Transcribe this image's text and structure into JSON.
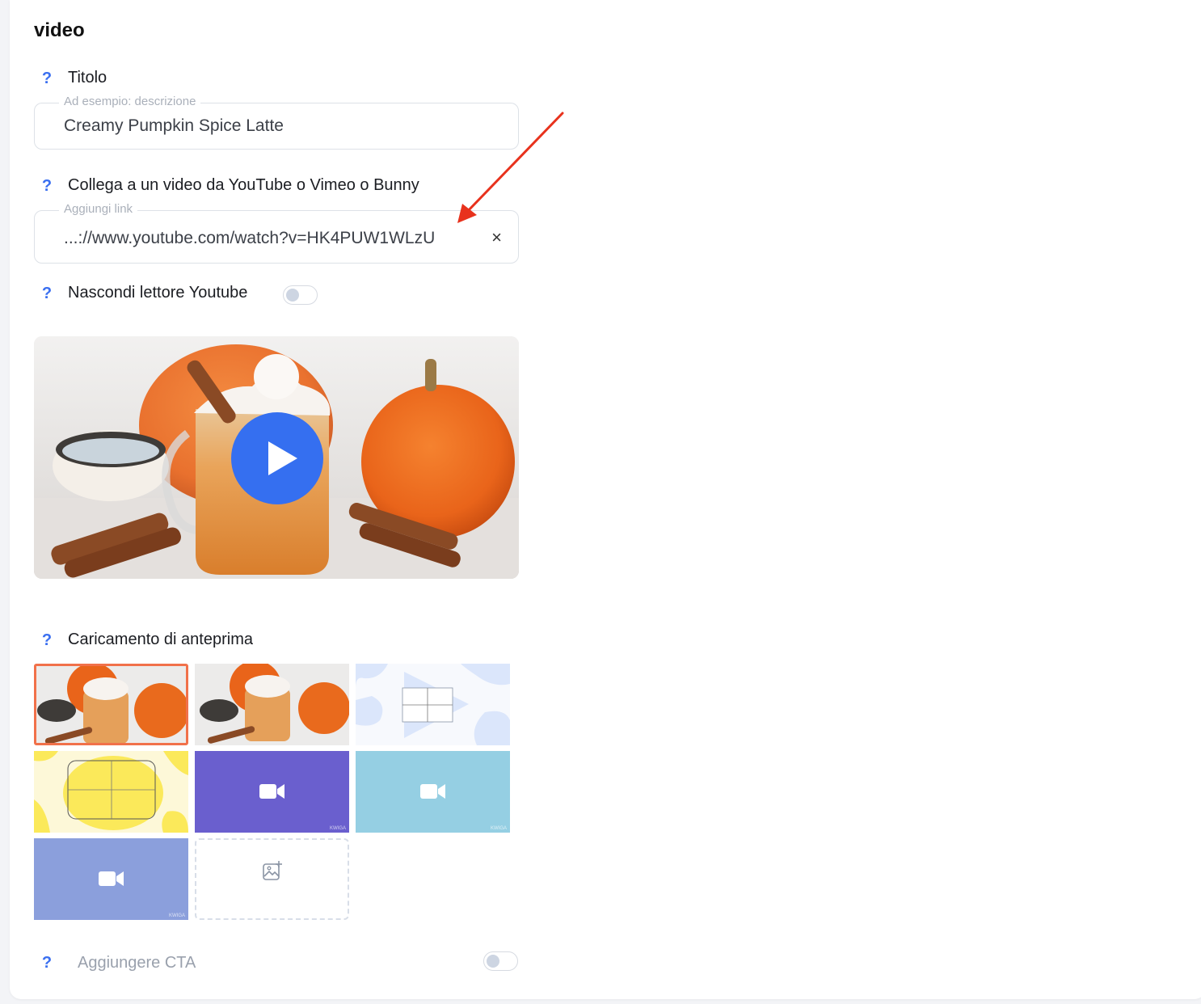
{
  "section": {
    "title": "video"
  },
  "help_icon": "?",
  "title_field": {
    "label": "Titolo",
    "legend": "Ad esempio: descrizione",
    "value": "Creamy Pumpkin Spice Latte"
  },
  "link_field": {
    "label": "Collega a un video da YouTube o Vimeo o Bunny",
    "legend": "Aggiungi link",
    "value": "...://www.youtube.com/watch?v=HK4PUW1WLzU",
    "clear_icon": "×"
  },
  "hide_player": {
    "label": "Nascondi lettore Youtube",
    "enabled": false
  },
  "preview_upload": {
    "label": "Caricamento di anteprima",
    "thumbnails": [
      {
        "kind": "photo",
        "selected": true
      },
      {
        "kind": "photo",
        "selected": false
      },
      {
        "kind": "pattern-blue",
        "selected": false
      },
      {
        "kind": "pattern-yellow",
        "selected": false
      },
      {
        "kind": "solid",
        "color": "#6a5fce",
        "brand": "KWIGA",
        "selected": false
      },
      {
        "kind": "solid",
        "color": "#95cfe3",
        "brand": "KWIGA",
        "selected": false
      },
      {
        "kind": "solid",
        "color": "#8b9fdc",
        "brand": "KWIGA",
        "selected": false
      }
    ]
  },
  "cta": {
    "label": "Aggiungere CTA",
    "enabled": false
  },
  "colors": {
    "accent": "#356ff0",
    "selected_border": "#f1714a",
    "annotation_arrow": "#e8321d"
  }
}
